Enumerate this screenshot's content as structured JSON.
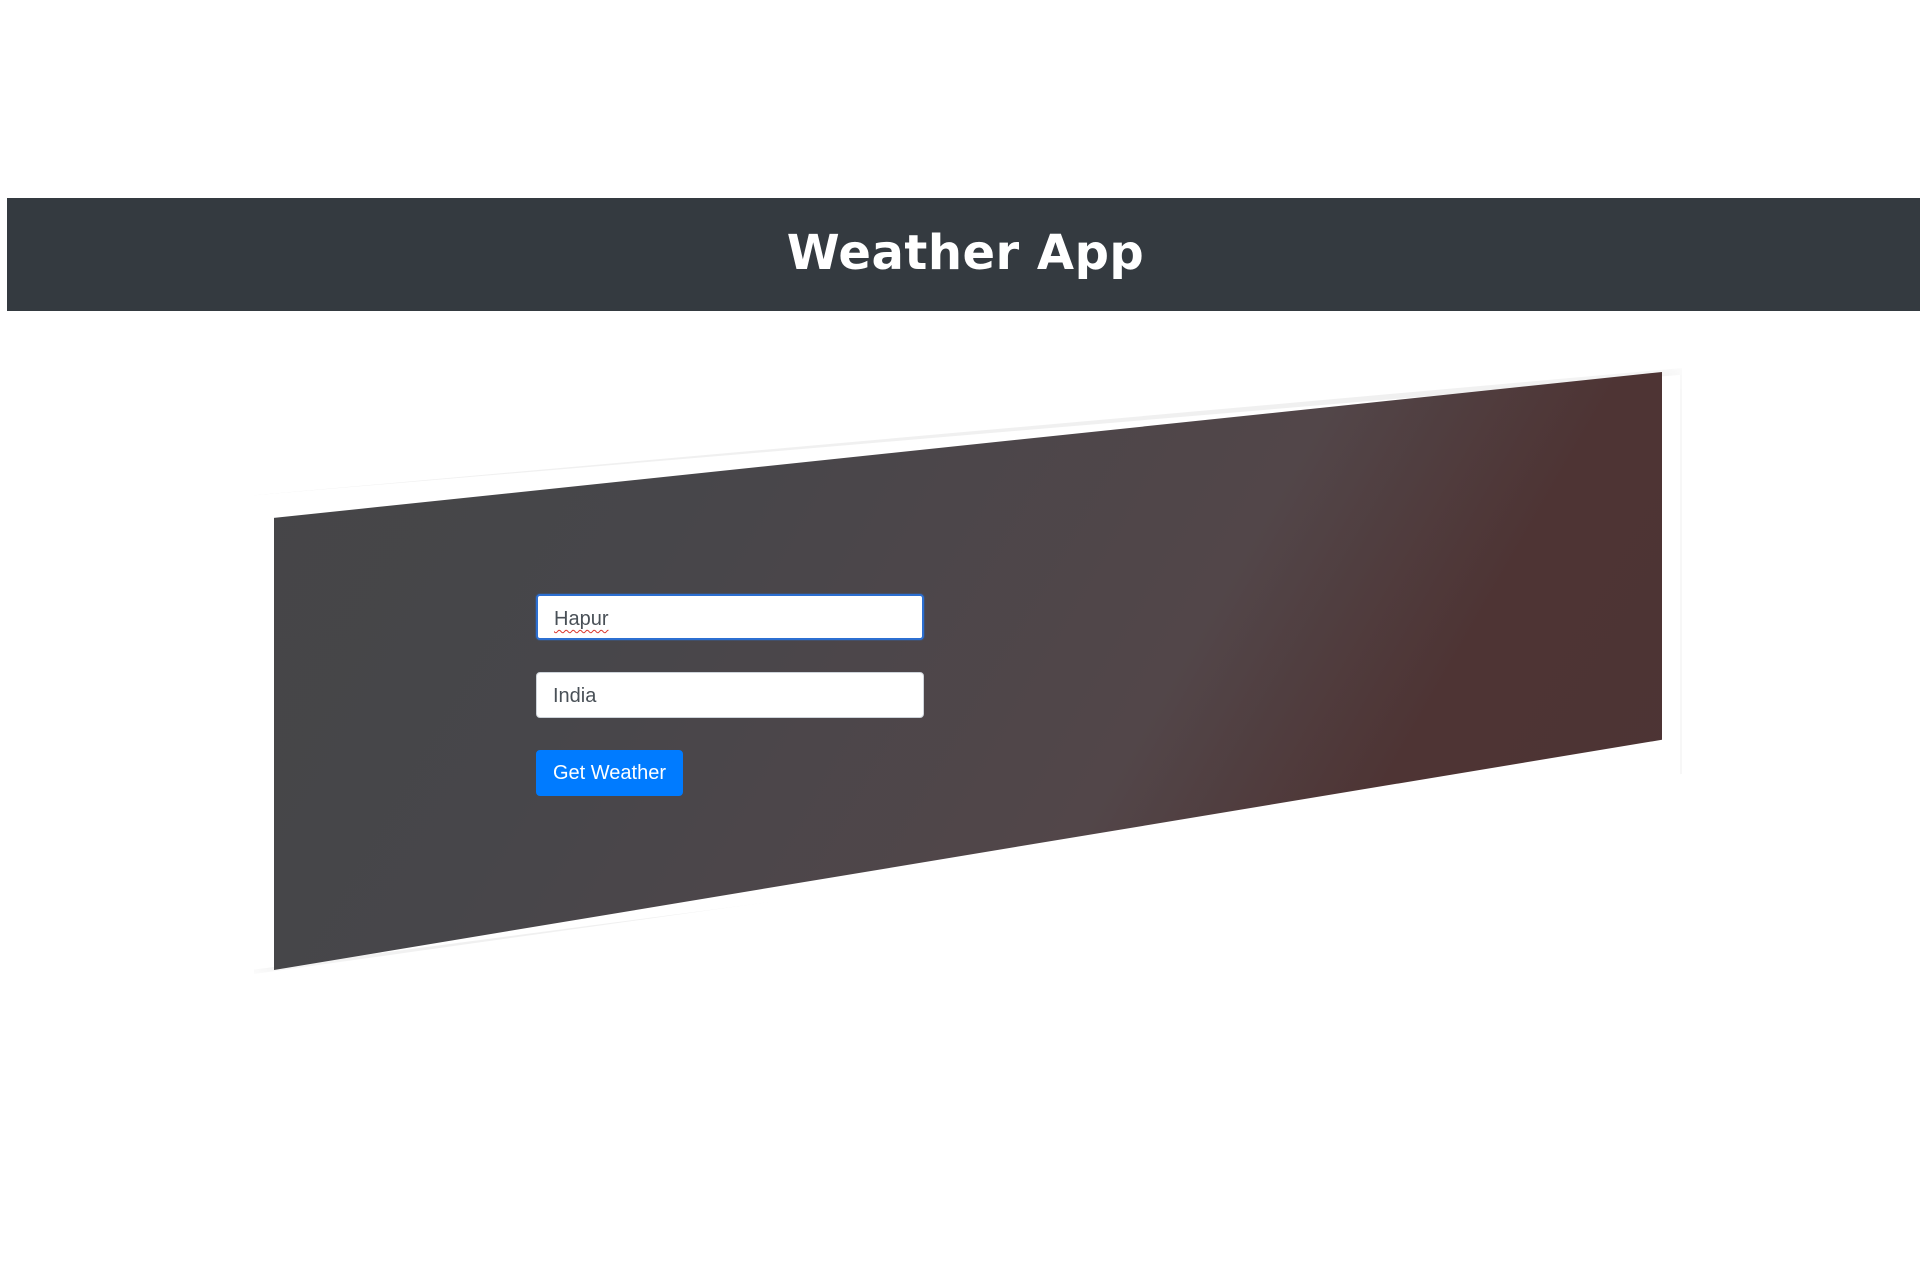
{
  "header": {
    "title": "Weather App",
    "background_color": "#343a40"
  },
  "form": {
    "city": {
      "value": "Hapur",
      "spellcheck_flagged": true
    },
    "country": {
      "value": "India"
    },
    "submit_label": "Get Weather",
    "submit_color": "#007bff"
  },
  "card": {
    "gradient_colors": [
      "#454547",
      "#524649",
      "#4e3434"
    ]
  }
}
